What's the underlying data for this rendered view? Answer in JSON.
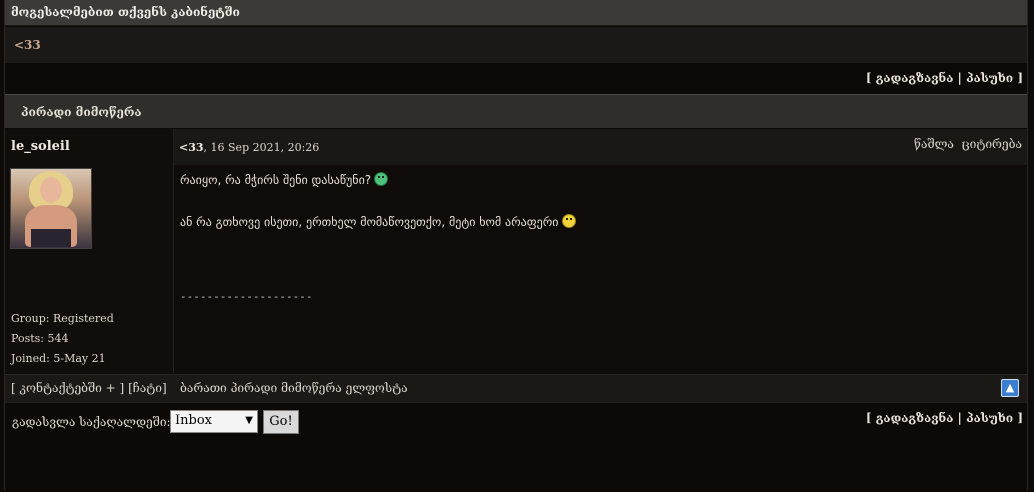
{
  "page_title": "მოგესალმებით თქვენს კაბინეტში",
  "subject": "<33",
  "actions": {
    "open_bracket": "[",
    "forward": "გადაგზავნა",
    "separator": "|",
    "reply": "პასუხი",
    "close_bracket": "]"
  },
  "section_header": "პირადი მიმოწერა",
  "author": {
    "username": "le_soleil",
    "group": "Group: Registered",
    "posts": "Posts: 544",
    "joined": "Joined: 5-May 21"
  },
  "post": {
    "subject": "<33",
    "date": ", 16 Sep 2021, 20:26",
    "delete": "წაშლა",
    "quote": "ციტირება",
    "line1": "რაიყო, რა მჭირს შენი დასაწუნი?",
    "line1_icon": "crying-laugh-emoji-icon",
    "line2": "ან რა გთხოვე ისეთი, ერთხელ მომაწოვეთქო, მეტი ხომ არაფერი",
    "line2_icon": "smile-emoji-icon",
    "signature": "--------------------"
  },
  "footer": {
    "contacts": "[ კონტაქტებში + ]",
    "block": "[ჩატი]",
    "pm_list": "ბარათი პირადი მიმოწერა ელფოსტა",
    "top_icon": "scroll-top-icon"
  },
  "folder_nav": {
    "label": "გადასვლა საქაღალდეში:",
    "selected": "Inbox",
    "go": "Go!"
  },
  "colors": {
    "background": "#0c0906",
    "title_bar": "#3b3a37",
    "subject_text": "#c9a88c",
    "go_button": "#d9d9d9"
  }
}
